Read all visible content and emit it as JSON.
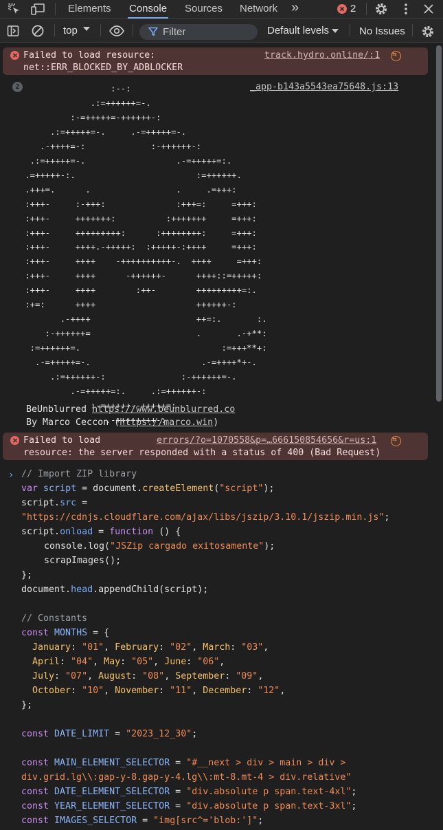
{
  "tabs": {
    "elements": "Elements",
    "console": "Console",
    "sources": "Sources",
    "network": "Network",
    "more": "»",
    "error_count": "2"
  },
  "toolbar": {
    "context": "top",
    "filter_placeholder": "Filter",
    "levels": "Default levels",
    "issues": "No Issues"
  },
  "messages": {
    "err1": {
      "line1": "Failed to load resource:",
      "line2": "net::ERR_BLOCKED_BY_ADBLOCKER",
      "source": "track.hydro.online/:1"
    },
    "log": {
      "repeat_count": "2",
      "source": "_app-b143a5543ea75648.js:13",
      "ascii_art": "                  :--:\n              .:=++++++=-.\n          :-=+++++=-++++++-:\n      .:=+++++=-.     .-=+++++=-.\n    .-++++=-:             :-++++++-:\n  .:=+++++=-.                  .-=+++++=:.\n .=+++++-:.                        :=++++++.\n .+++=.      .                 .     .=+++:\n :+++-     :-+++:              :+++=:     =+++:\n :+++-     +++++++:          :+++++++     =+++:\n :+++-     +++++++++:      :++++++++:     =+++:\n :+++-     ++++.-+++++:  :+++++-:++++     =+++:\n :+++-     ++++    -++++++++++-.  ++++     =+++:\n :+++-     ++++      -++++++-      ++++::=+++++:\n :+++-     ++++        :++-        +++++++++=:.\n :+=:      ++++                    ++++++-:\n        .-++++                     ++=:.       :.\n     :-++++++=                     .       .-+**:\n  :=++++++=.                            :=+++**+:\n   .-=+++++=-.                      .-=++++*+-.\n      .:=++++++-:               :-++++++=-.\n          .-=+++++=:.     .:=++++++-:\n              :-=+++++--+++++=:.\n                 .-++++++++-:\n                    .:==-.",
      "credit1_text": "BeUnblurred ",
      "credit1_link": "https://www.beunblurred.co",
      "credit2_text": "By Marco Ceccon (",
      "credit2_link": "https://marco.win",
      "credit2_end": ")"
    },
    "err2": {
      "line1": "Failed to load",
      "line2": "resource: the server responded with a status of 400 (Bad Request)",
      "source": "errors/?o=1070558&p=…666150854656&r=us:1"
    }
  },
  "code": {
    "comment_import": "// Import ZIP library",
    "kw_var": "var",
    "var_script": "script",
    "eq": " = ",
    "document": "document",
    "dot": ".",
    "createElement": "createElement",
    "str_script": "\"script\"",
    "close_semi": ");",
    "open_paren": "(",
    "src_prop": "src",
    "cdn_url": "\"https://cdnjs.cloudflare.com/ajax/libs/jszip/3.10.1/jszip.min.js\"",
    "semi": ";",
    "onload_prop": "onload",
    "kw_function": "function",
    "fn_sig": " () {",
    "console_log": "console.log(",
    "str_loaded": "\"JSZip cargado exitosamente\"",
    "scrap_call": "scrapImages();",
    "close_brace_semi": "};",
    "head_prop": "head",
    "append_child": ".appendChild(script);",
    "comment_constants": "// Constants",
    "kw_const": "const",
    "months_name": "MONTHS",
    "open_brace": " = {",
    "m_jan": "January",
    "v_jan": "\"01\"",
    "m_feb": "February",
    "v_feb": "\"02\"",
    "m_mar": "March",
    "v_mar": "\"03\"",
    "m_apr": "April",
    "v_apr": "\"04\"",
    "m_may": "May",
    "v_may": "\"05\"",
    "m_jun": "June",
    "v_jun": "\"06\"",
    "m_jul": "July",
    "v_jul": "\"07\"",
    "m_aug": "August",
    "v_aug": "\"08\"",
    "m_sep": "September",
    "v_sep": "\"09\"",
    "m_oct": "October",
    "v_oct": "\"10\"",
    "m_nov": "November",
    "v_nov": "\"11\"",
    "m_dec": "December",
    "v_dec": "\"12\"",
    "colon": ": ",
    "comma": ", ",
    "comma_end": ",",
    "date_limit_name": "DATE_LIMIT",
    "date_limit_val": "\"2023_12_30\"",
    "main_sel_name": "MAIN_ELEMENT_SELECTOR",
    "main_sel_val1": "\"#__next > div > main > div >",
    "main_sel_val2": "div.grid.lg\\\\:gap-y-8.gap-y-4.lg\\\\:mt-8.mt-4 > div.relative\"",
    "date_sel_name": "DATE_ELEMENT_SELECTOR",
    "date_sel_val": "\"div.absolute p span.text-4xl\"",
    "year_sel_name": "YEAR_ELEMENT_SELECTOR",
    "year_sel_val": "\"div.absolute p span.text-3xl\"",
    "images_sel_name": "IMAGES_SELECTOR",
    "images_sel_val": "\"img[src^='blob:']\""
  }
}
